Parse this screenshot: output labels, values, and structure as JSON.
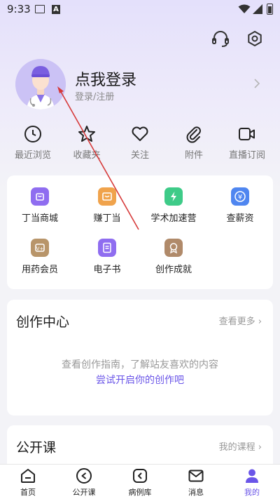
{
  "status_bar": {
    "time": "9:33"
  },
  "profile": {
    "title": "点我登录",
    "subtitle": "登录/注册"
  },
  "quick_actions": [
    {
      "label": "最近浏览",
      "icon": "clock-icon"
    },
    {
      "label": "收藏夹",
      "icon": "star-icon"
    },
    {
      "label": "关注",
      "icon": "heart-icon"
    },
    {
      "label": "附件",
      "icon": "paperclip-icon"
    },
    {
      "label": "直播订阅",
      "icon": "video-camera-icon"
    }
  ],
  "services": [
    {
      "label": "丁当商城",
      "icon": "shop-bag-icon",
      "color": "#8f6df0"
    },
    {
      "label": "赚丁当",
      "icon": "wallet-icon",
      "color": "#f0a34c"
    },
    {
      "label": "学术加速营",
      "icon": "lightning-icon",
      "color": "#3ecb88"
    },
    {
      "label": "查薪资",
      "icon": "yuan-icon",
      "color": "#4f86f0"
    },
    {
      "label": "用药会员",
      "icon": "vip-icon",
      "color": "#b8956a"
    },
    {
      "label": "电子书",
      "icon": "ebook-icon",
      "color": "#8f6df0"
    },
    {
      "label": "创作成就",
      "icon": "medal-icon",
      "color": "#b08a6a"
    }
  ],
  "creation": {
    "title": "创作中心",
    "more": "查看更多",
    "description": "查看创作指南，了解站友喜欢的内容",
    "link": "尝试开启你的创作吧"
  },
  "course": {
    "title": "公开课",
    "more": "我的课程"
  },
  "nav": [
    {
      "label": "首页",
      "icon": "home-icon"
    },
    {
      "label": "公开课",
      "icon": "play-circle-icon"
    },
    {
      "label": "病例库",
      "icon": "case-library-icon"
    },
    {
      "label": "消息",
      "icon": "mail-icon"
    },
    {
      "label": "我的",
      "icon": "person-icon",
      "active": true
    }
  ],
  "colors": {
    "accent": "#6a55e8",
    "annotation_arrow": "#d63a3a"
  }
}
